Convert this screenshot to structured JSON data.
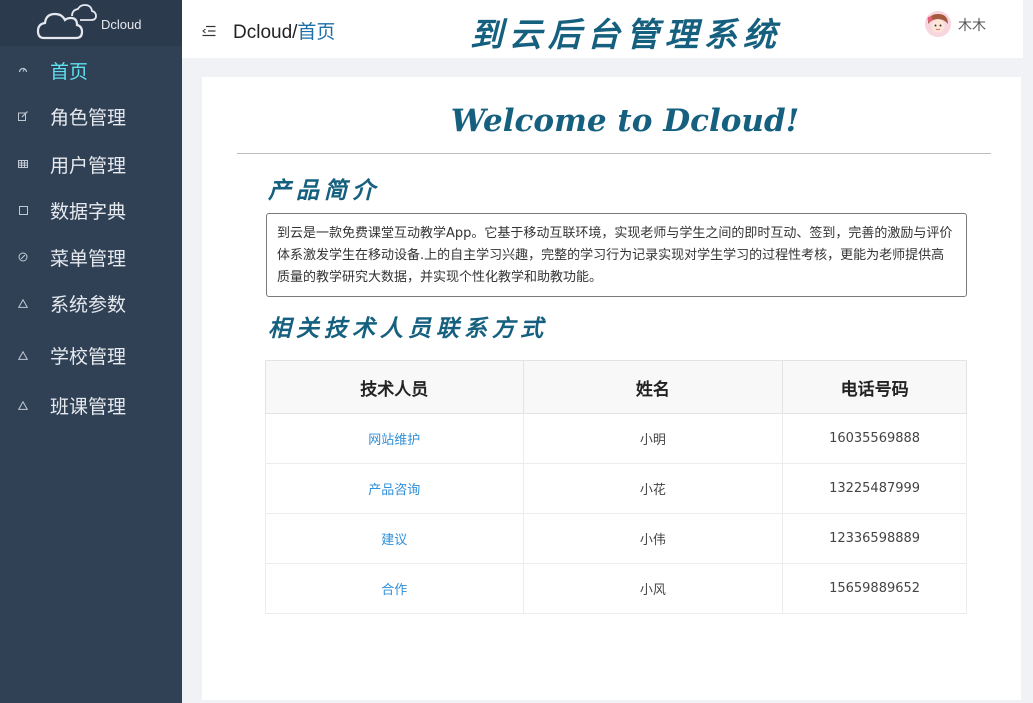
{
  "app": {
    "logo_text": "Dcloud",
    "system_title": "到云后台管理系统"
  },
  "sidebar": {
    "items": [
      {
        "label": "首页",
        "icon": "gauge-icon",
        "active": true
      },
      {
        "label": "角色管理",
        "icon": "edit-icon"
      },
      {
        "label": "用户管理",
        "icon": "grid-icon"
      },
      {
        "label": "数据字典",
        "icon": "square-icon"
      },
      {
        "label": "菜单管理",
        "icon": "circle-icon"
      },
      {
        "label": "系统参数",
        "icon": "warning-icon"
      },
      {
        "label": "学校管理",
        "icon": "warning-icon"
      },
      {
        "label": "班课管理",
        "icon": "warning-icon"
      }
    ]
  },
  "header": {
    "breadcrumb_root": "Dcloud/",
    "breadcrumb_current": "首页",
    "user_name": "木木"
  },
  "main": {
    "welcome": "Welcome to Dcloud!",
    "intro_title": "产品简介",
    "intro_text": "到云是一款免费课堂互动教学App。它基于移动互联环境，实现老师与学生之间的即时互动、签到，完善的激励与评价体系激发学生在移动设备.上的自主学习兴趣，完整的学习行为记录实现对学生学习的过程性考核，更能为老师提供高质量的教学研究大数据，并实现个性化教学和助教功能。",
    "contact_title": "相关技术人员联系方式",
    "table": {
      "headers": [
        "技术人员",
        "姓名",
        "电话号码"
      ],
      "rows": [
        [
          "网站维护",
          "小明",
          "16035569888"
        ],
        [
          "产品咨询",
          "小花",
          "13225487999"
        ],
        [
          "建议",
          "小伟",
          "12336598889"
        ],
        [
          "合作",
          "小风",
          "15659889652"
        ]
      ]
    }
  },
  "colors": {
    "sidebar_bg": "#304156",
    "active_menu": "#5fe0ee",
    "title_blue": "#16607f",
    "link_blue": "#2f8fd8"
  }
}
